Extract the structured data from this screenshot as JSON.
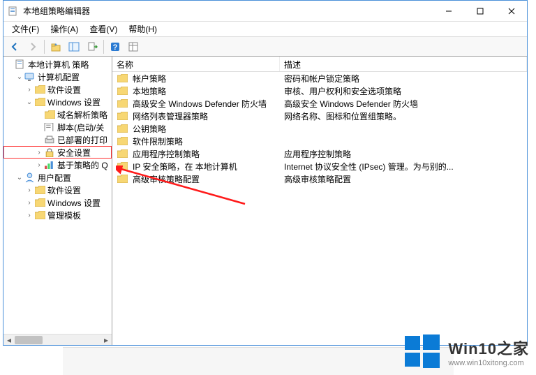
{
  "window": {
    "title": "本地组策略编辑器"
  },
  "menu": {
    "file": "文件(F)",
    "action": "操作(A)",
    "view": "查看(V)",
    "help": "帮助(H)"
  },
  "tree": {
    "root": "本地计算机 策略",
    "computer_config": "计算机配置",
    "software_settings": "软件设置",
    "windows_settings": "Windows 设置",
    "name_resolution": "域名解析策略",
    "scripts": "脚本(启动/关",
    "deployed_printers": "已部署的打印",
    "security_settings": "安全设置",
    "policy_based_qos": "基于策略的 Q",
    "user_config": "用户配置",
    "user_software_settings": "软件设置",
    "user_windows_settings": "Windows 设置",
    "admin_templates": "管理模板"
  },
  "columns": {
    "name": "名称",
    "description": "描述"
  },
  "rows": [
    {
      "name": "帐户策略",
      "desc": "密码和帐户锁定策略"
    },
    {
      "name": "本地策略",
      "desc": "审核、用户权利和安全选项策略"
    },
    {
      "name": "高级安全 Windows Defender 防火墙",
      "desc": "高级安全 Windows Defender 防火墙"
    },
    {
      "name": "网络列表管理器策略",
      "desc": "网络名称、图标和位置组策略。"
    },
    {
      "name": "公钥策略",
      "desc": ""
    },
    {
      "name": "软件限制策略",
      "desc": ""
    },
    {
      "name": "应用程序控制策略",
      "desc": "应用程序控制策略"
    },
    {
      "name": "IP 安全策略，在 本地计算机",
      "desc": "Internet 协议安全性 (IPsec) 管理。为与别的..."
    },
    {
      "name": "高级审核策略配置",
      "desc": "高级审核策略配置"
    }
  ],
  "watermark": {
    "title": "Win10之家",
    "url": "www.win10xitong.com"
  }
}
